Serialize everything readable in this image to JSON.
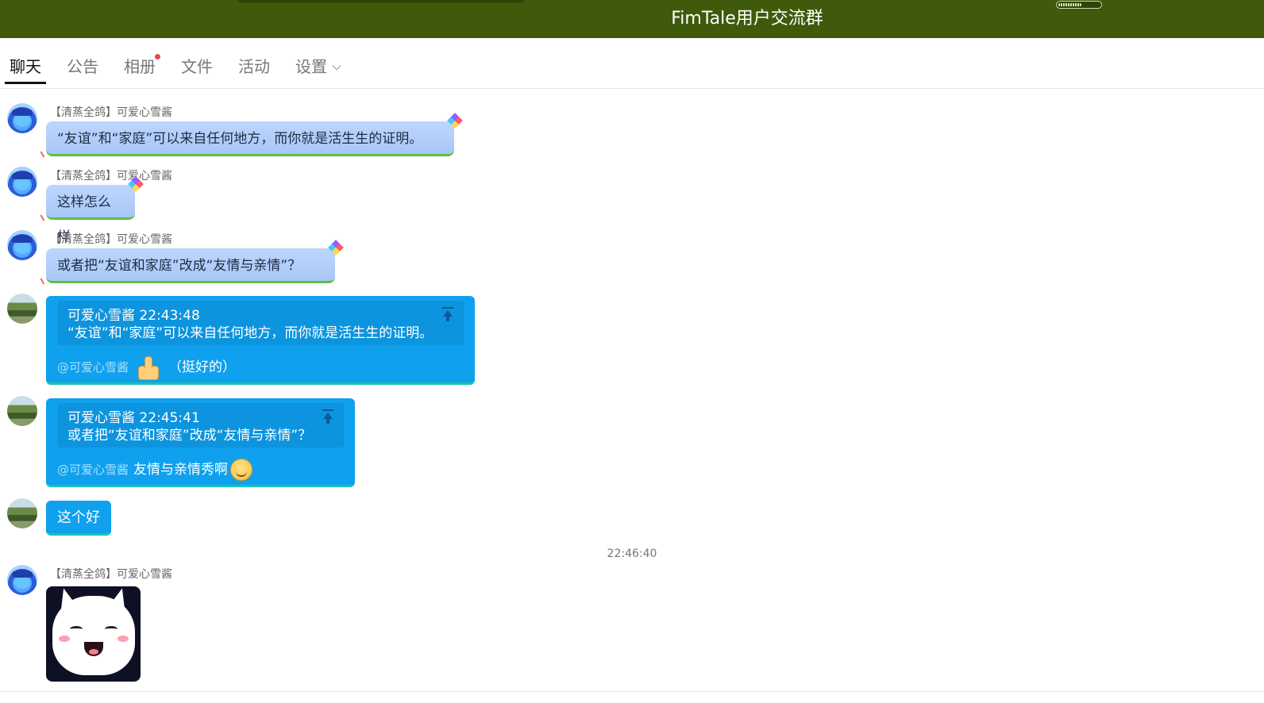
{
  "header": {
    "title": "FimTale用户交流群",
    "bg_color": "#3e5a0a",
    "battery_level": 0.55
  },
  "tabs": [
    {
      "label": "聊天",
      "active": true
    },
    {
      "label": "公告"
    },
    {
      "label": "相册",
      "badge_dot": true
    },
    {
      "label": "文件"
    },
    {
      "label": "活动"
    },
    {
      "label": "设置",
      "has_dropdown": true
    }
  ],
  "messages": [
    {
      "sender": "【清蒸全鸽】可爱心雪酱",
      "text": "“友谊”和“家庭”可以来自任何地方，而你就是活生生的证明。"
    },
    {
      "sender": "【清蒸全鸽】可爱心雪酱",
      "text": "这样怎么样"
    },
    {
      "sender": "【清蒸全鸽】可爱心雪酱",
      "text": "或者把“友谊和家庭”改成“友情与亲情”？"
    }
  ],
  "replies": [
    {
      "quote_header": "可爱心雪酱   22:43:48",
      "quote_text": " “友谊”和“家庭”可以来自任何地方，而你就是活生生的证明。",
      "mention": "@可爱心雪酱",
      "text": "（挺好的）",
      "emoji": "thumbs-up-icon"
    },
    {
      "quote_header": "可爱心雪酱   22:45:41",
      "quote_text": "或者把“友谊和家庭”改成“友情与亲情”？",
      "mention": "@可爱心雪酱",
      "text": "友情与亲情秀啊",
      "emoji": "grin-emoji-icon"
    }
  ],
  "simple_reply": "这个好",
  "divider_time": "22:46:40",
  "last_sender": "【清蒸全鸽】可爱心雪酱",
  "colors": {
    "self_bubble": "#0fa0ee",
    "other_bubble": "#bcd6ff",
    "bubble_underline": "#5cc04a"
  }
}
